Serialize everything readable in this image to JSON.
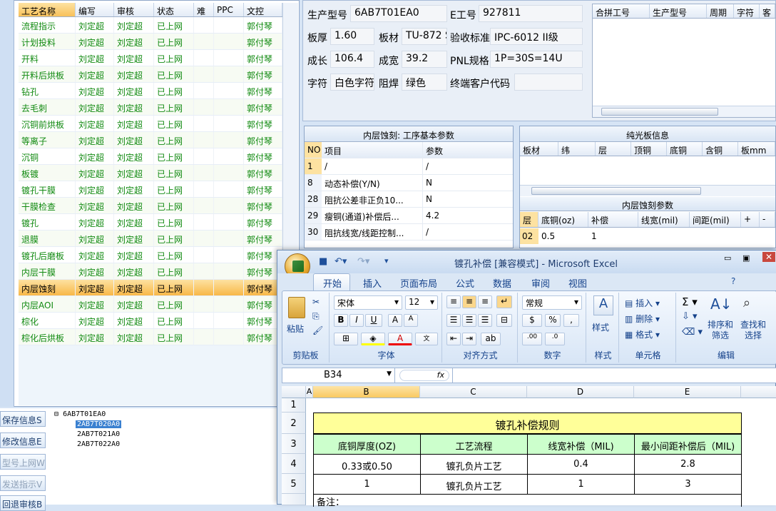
{
  "process_grid": {
    "headers": [
      "工艺名称",
      "编写",
      "审核",
      "状态",
      "难",
      "PPC",
      "文控"
    ],
    "rows": [
      [
        "流程指示",
        "刘定超",
        "刘定超",
        "已上网",
        "",
        "",
        "郭付琴"
      ],
      [
        "计划投料",
        "刘定超",
        "刘定超",
        "已上网",
        "",
        "",
        "郭付琴"
      ],
      [
        "开料",
        "刘定超",
        "刘定超",
        "已上网",
        "",
        "",
        "郭付琴"
      ],
      [
        "开料后烘板",
        "刘定超",
        "刘定超",
        "已上网",
        "",
        "",
        "郭付琴"
      ],
      [
        "钻孔",
        "刘定超",
        "刘定超",
        "已上网",
        "",
        "",
        "郭付琴"
      ],
      [
        "去毛刺",
        "刘定超",
        "刘定超",
        "已上网",
        "",
        "",
        "郭付琴"
      ],
      [
        "沉铜前烘板",
        "刘定超",
        "刘定超",
        "已上网",
        "",
        "",
        "郭付琴"
      ],
      [
        "等离子",
        "刘定超",
        "刘定超",
        "已上网",
        "",
        "",
        "郭付琴"
      ],
      [
        "沉铜",
        "刘定超",
        "刘定超",
        "已上网",
        "",
        "",
        "郭付琴"
      ],
      [
        "板镀",
        "刘定超",
        "刘定超",
        "已上网",
        "",
        "",
        "郭付琴"
      ],
      [
        "镀孔干膜",
        "刘定超",
        "刘定超",
        "已上网",
        "",
        "",
        "郭付琴"
      ],
      [
        "干膜检查",
        "刘定超",
        "刘定超",
        "已上网",
        "",
        "",
        "郭付琴"
      ],
      [
        "镀孔",
        "刘定超",
        "刘定超",
        "已上网",
        "",
        "",
        "郭付琴"
      ],
      [
        "退膜",
        "刘定超",
        "刘定超",
        "已上网",
        "",
        "",
        "郭付琴"
      ],
      [
        "镀孔后磨板",
        "刘定超",
        "刘定超",
        "已上网",
        "",
        "",
        "郭付琴"
      ],
      [
        "内层干膜",
        "刘定超",
        "刘定超",
        "已上网",
        "",
        "",
        "郭付琴"
      ],
      [
        "内层蚀刻",
        "刘定超",
        "刘定超",
        "已上网",
        "",
        "",
        "郭付琴"
      ],
      [
        "内层AOI",
        "刘定超",
        "刘定超",
        "已上网",
        "",
        "",
        "郭付琴"
      ],
      [
        "棕化",
        "刘定超",
        "刘定超",
        "已上网",
        "",
        "",
        "郭付琴"
      ],
      [
        "棕化后烘板",
        "刘定超",
        "刘定超",
        "已上网",
        "",
        "",
        "郭付琴"
      ]
    ]
  },
  "side_buttons": [
    "保存信息S",
    "修改信息E",
    "型号上网W",
    "发送指示V",
    "回退审核B"
  ],
  "tree": {
    "root": "6AB7T01EA0",
    "children": [
      "2AB7T020A0",
      "2AB7T021A0",
      "2AB7T022A0"
    ]
  },
  "info": {
    "model_label": "生产型号",
    "model_value": "6AB7T01EA0",
    "e_label": "E工号",
    "e_value": "927811",
    "thick_label": "板厚",
    "thick_value": "1.60",
    "material_label": "板材",
    "material_value": "TU-872 S",
    "accept_label": "验收标准",
    "accept_value": "IPC-6012 II级",
    "length_label": "成长",
    "length_value": "106.4",
    "width_label": "成宽",
    "width_value": "39.2",
    "pnl_label": "PNL规格",
    "pnl_value": "1P=30S=14U",
    "char_label": "字符",
    "char_value": "白色字符",
    "mask_label": "阻焊",
    "mask_value": "绿色",
    "customer_label": "终端客户代码",
    "customer_value": ""
  },
  "merge_grid": {
    "headers": [
      "合拼工号",
      "生产型号",
      "周期",
      "字符",
      "客"
    ]
  },
  "param_panel": {
    "title": "内层蚀刻: 工序基本参数",
    "headers": [
      "NO",
      "项目",
      "参数"
    ],
    "rows": [
      [
        "1",
        "/",
        "/"
      ],
      [
        "8",
        "动态补偿(Y/N)",
        "N"
      ],
      [
        "28",
        "阻抗公差非正负10...",
        "N"
      ],
      [
        "29",
        "瘦铜(通道)补偿后...",
        "4.2"
      ],
      [
        "30",
        "阻抗线宽/线距控制...",
        "/"
      ]
    ]
  },
  "plain_panel": {
    "title": "纯光板信息",
    "headers": [
      "板材",
      "纬",
      "层",
      "顶铜",
      "底铜",
      "含铜",
      "板mm"
    ],
    "sub_title": "内层蚀刻参数",
    "sub_headers": [
      "层",
      "底铜(oz)",
      "补偿",
      "线宽(mil)",
      "间距(mil)",
      "+",
      "-"
    ],
    "sub_row": [
      "02",
      "0.5",
      "1",
      "",
      "",
      "",
      ""
    ]
  },
  "excel": {
    "title": "镀孔补偿  [兼容模式] - Microsoft Excel",
    "tabs": [
      "开始",
      "插入",
      "页面布局",
      "公式",
      "数据",
      "审阅",
      "视图"
    ],
    "font_name": "宋体",
    "font_size": "12",
    "number_format": "常规",
    "groups": [
      "剪贴板",
      "字体",
      "对齐方式",
      "数字",
      "样式",
      "单元格",
      "编辑"
    ],
    "paste": "粘贴",
    "style": "样式",
    "insert": "插入",
    "delete": "删除",
    "format": "格式",
    "sort": "排序和筛选",
    "find": "查找和选择",
    "name_box": "B34",
    "fx": "fx",
    "columns": [
      "A",
      "B",
      "C",
      "D",
      "E"
    ],
    "rows": [
      "1",
      "2",
      "3",
      "4",
      "5"
    ],
    "sheet_title": "镀孔补偿规则",
    "table_headers": [
      "底铜厚度(OZ)",
      "工艺流程",
      "线宽补偿（MIL)",
      "最小间距补偿后（MIL)"
    ],
    "table_rows": [
      [
        "0.33或0.50",
        "镀孔负片工艺",
        "0.4",
        "2.8"
      ],
      [
        "1",
        "镀孔负片工艺",
        "1",
        "3"
      ]
    ],
    "note": "备注："
  },
  "colors": {
    "accent": "#15428b",
    "green_text": "#118a11",
    "selected_row": "#f8b748",
    "sheet_yellow": "#ffff99",
    "sheet_green": "#ccffcc"
  }
}
